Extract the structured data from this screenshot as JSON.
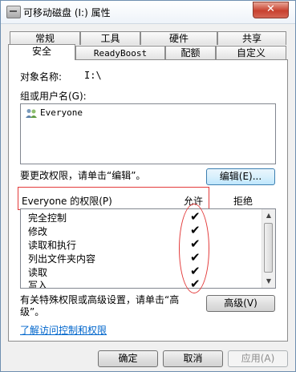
{
  "window": {
    "title": "可移动磁盘 (I:) 属性",
    "close_glyph": "✕"
  },
  "tabs_row1": [
    "常规",
    "工具",
    "硬件",
    "共享"
  ],
  "tabs_row2": [
    "安全",
    "ReadyBoost",
    "配额",
    "自定义"
  ],
  "active_tab": "安全",
  "object_label": "对象名称:",
  "object_value": "I:\\",
  "group_label": "组或用户名(G):",
  "users": [
    "Everyone"
  ],
  "change_hint": "要更改权限，请单击“编辑”。",
  "edit_button": "编辑(E)...",
  "perm_header": "Everyone 的权限(P)",
  "allow_header": "允许",
  "deny_header": "拒绝",
  "permissions": [
    {
      "name": "完全控制",
      "allow": "✔"
    },
    {
      "name": "修改",
      "allow": "✔"
    },
    {
      "name": "读取和执行",
      "allow": "✔"
    },
    {
      "name": "列出文件夹内容",
      "allow": "✔"
    },
    {
      "name": "读取",
      "allow": "✔"
    },
    {
      "name": "写入",
      "allow": "✔"
    }
  ],
  "advanced_hint_line1": "有关特殊权限或高级设置，请单击“高",
  "advanced_hint_line2": "级”。",
  "advanced_button": "高级(V)",
  "learn_link": "了解访问控制和权限",
  "ok_button": "确定",
  "cancel_button": "取消",
  "apply_button": "应用(A)",
  "scroll_up": "▲",
  "scroll_down": "▼"
}
